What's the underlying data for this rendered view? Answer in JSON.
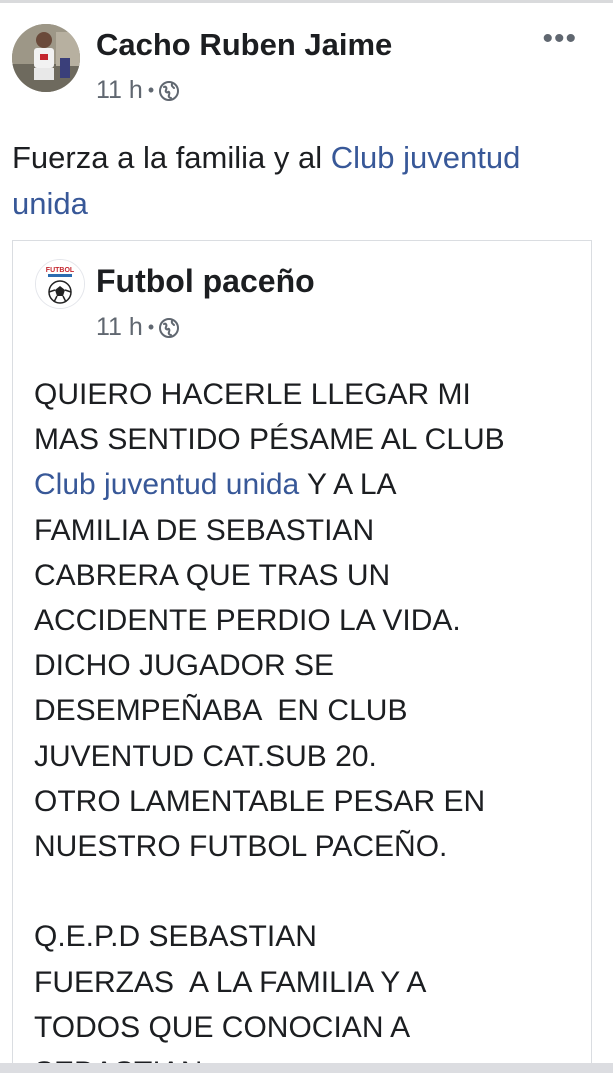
{
  "post": {
    "author": "Cacho Ruben Jaime",
    "time": "11 h",
    "separator": "•",
    "privacy_icon": "globe-icon",
    "more_icon": "more-options-icon",
    "more_glyph": "•••",
    "text_before": "Fuerza a la familia y al ",
    "text_link": "Club juventud unida"
  },
  "shared_post": {
    "author": "Futbol paceño",
    "logo_text": "FUTBOL",
    "time": "11 h",
    "separator": "•",
    "privacy_icon": "globe-icon",
    "line1": "QUIERO HACERLE LLEGAR MI",
    "line2": "MAS SENTIDO PÉSAME AL CLUB",
    "line3_link": "Club juventud unida",
    "line3_rest": " Y A LA",
    "line4": "FAMILIA DE SEBASTIAN",
    "line5": "CABRERA QUE TRAS UN",
    "line6": "ACCIDENTE PERDIO LA VIDA.",
    "line7": "DICHO JUGADOR SE",
    "line8": "DESEMPEÑABA  EN CLUB",
    "line9": "JUVENTUD CAT.SUB 20.",
    "line10": "OTRO LAMENTABLE PESAR EN",
    "line11": "NUESTRO FUTBOL PACEÑO.",
    "line12": "Q.E.P.D SEBASTIAN",
    "line13": "FUERZAS  A LA FAMILIA Y A",
    "line14": "TODOS QUE CONOCIAN A",
    "line15": "SEBASTIAN"
  },
  "colors": {
    "link": "#385898",
    "text": "#1c1e21",
    "secondary": "#606770",
    "border": "#dadde1"
  }
}
